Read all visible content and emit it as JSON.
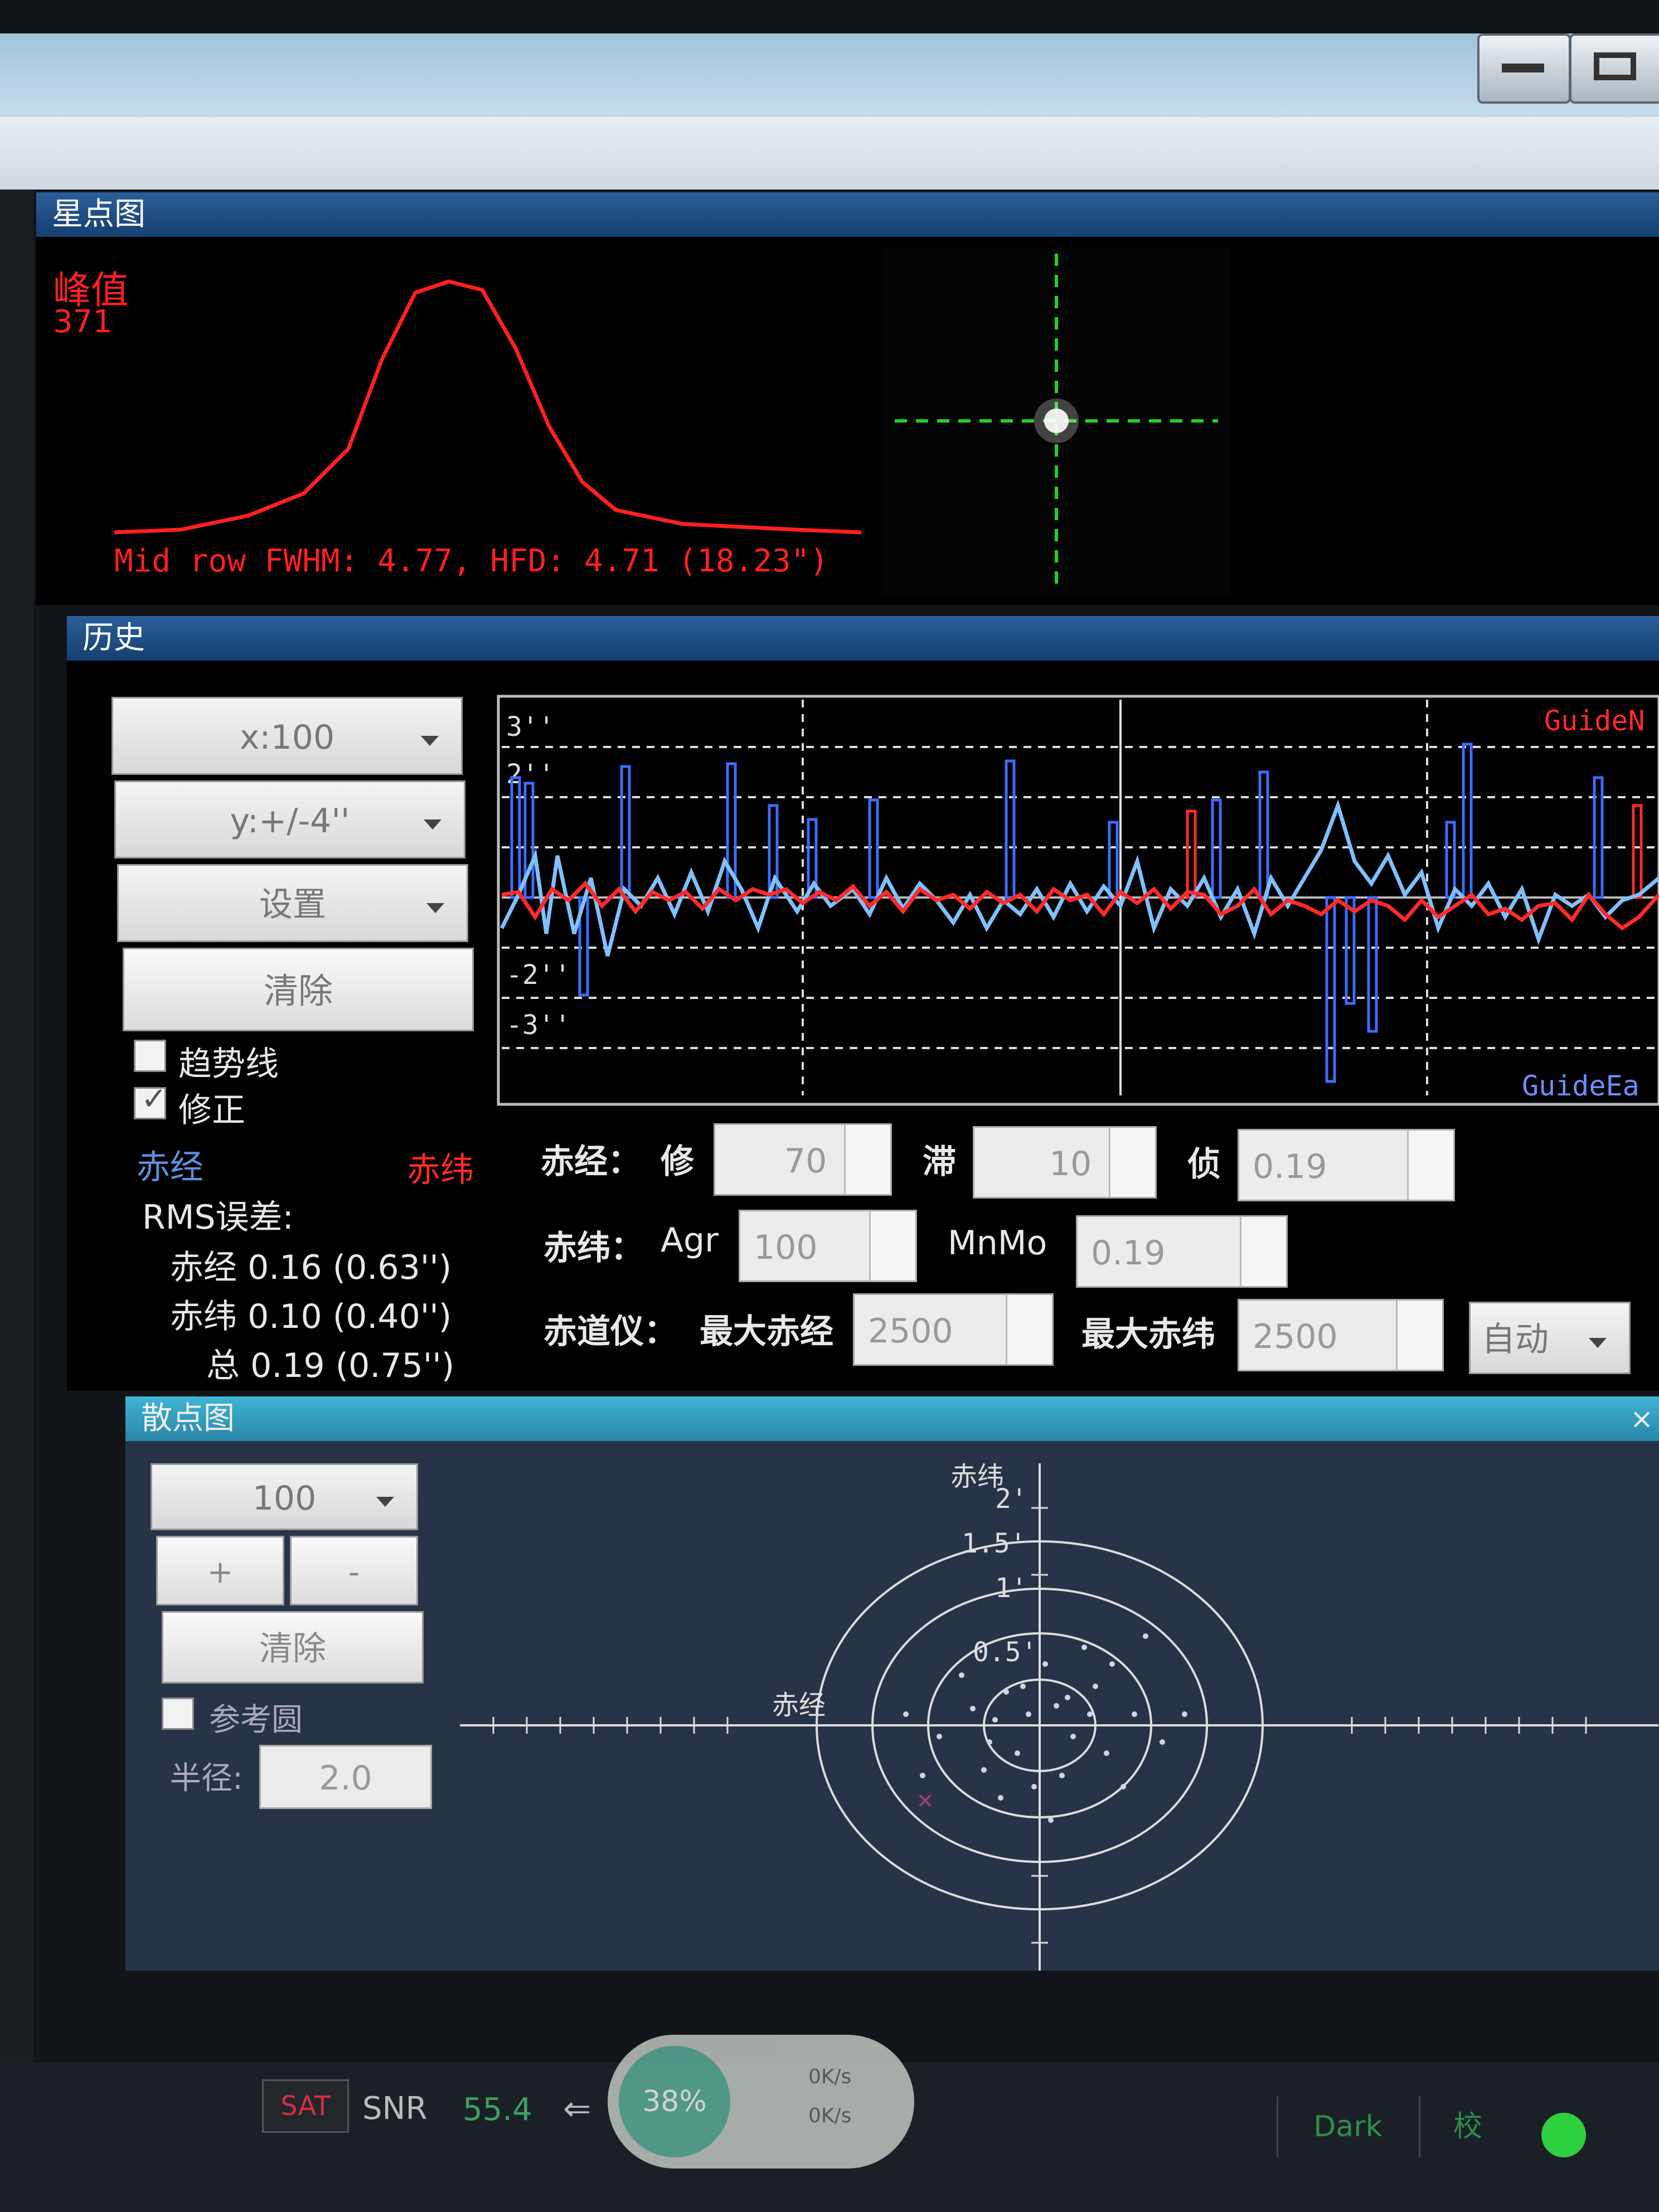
{
  "star_profile": {
    "title": "星点图",
    "peak_label": "峰值",
    "peak_value": "371",
    "fwhm_text": "Mid row FWHM: 4.77, HFD: 4.71 (18.23\")"
  },
  "history": {
    "title": "历史",
    "x_scale": "x:100",
    "y_scale": "y:+/-4''",
    "settings_label": "设置",
    "clear_label": "清除",
    "trendline_label": "趋势线",
    "correction_label": "修正",
    "ra_label": "赤经",
    "dec_label": "赤纬",
    "rms_title": "RMS误差:",
    "rms_ra": "赤经 0.16 (0.63'')",
    "rms_dec": "赤纬 0.10 (0.40'')",
    "rms_total": "总 0.19 (0.75'')",
    "legend_top": "GuideN",
    "legend_bottom": "GuideEa",
    "y_ticks": [
      "3''",
      "2''",
      "-2''",
      "-3''"
    ]
  },
  "params": {
    "ra_row_label": "赤经：",
    "ra_fix_label": "修",
    "ra_fix_value": "70",
    "ra_lag_label": "滞",
    "ra_lag_value": "10",
    "ra_detect_label": "侦",
    "ra_detect_value": "0.19",
    "dec_row_label": "赤纬：",
    "dec_agr_label": "Agr",
    "dec_agr_value": "100",
    "dec_minmo_label": "MnMo",
    "dec_minmo_value": "0.19",
    "mount_row_label": "赤道仪：",
    "max_ra_label": "最大赤经",
    "max_ra_value": "2500",
    "max_dec_label": "最大赤纬",
    "max_dec_value": "2500",
    "mode_value": "自动"
  },
  "scatter": {
    "title": "散点图",
    "count_value": "100",
    "plus_label": "+",
    "minus_label": "-",
    "clear_label": "清除",
    "ref_circle_label": "参考圆",
    "radius_label": "半径:",
    "radius_value": "2.0",
    "axis_dec_label": "赤纬",
    "axis_ra_label": "赤经",
    "ring_labels": [
      "2'",
      "1.5'",
      "1'",
      "0.5'"
    ]
  },
  "statusbar": {
    "sat_label": "SAT",
    "snr_label": "SNR",
    "snr_value": "55.4",
    "progress_text": "38%",
    "rate_up": "0K/s",
    "rate_down": "0K/s",
    "dark_label": "Dark",
    "cal_label": "校"
  },
  "colors": {
    "ra_blue": "#7fc0ff",
    "dec_red": "#ff2a2a",
    "profile_red": "#ff2020",
    "crosshair_green": "#23d023"
  }
}
